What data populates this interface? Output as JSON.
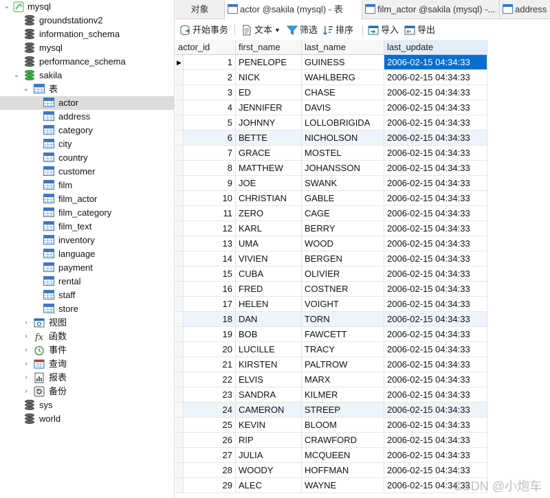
{
  "tree": {
    "connection": "mysql",
    "databases_top": [
      "groundstationv2",
      "information_schema",
      "mysql",
      "performance_schema"
    ],
    "open_db": "sakila",
    "tables_folder": "表",
    "tables": [
      "actor",
      "address",
      "category",
      "city",
      "country",
      "customer",
      "film",
      "film_actor",
      "film_category",
      "film_text",
      "inventory",
      "language",
      "payment",
      "rental",
      "staff",
      "store"
    ],
    "selected_table": "actor",
    "folders": [
      {
        "label": "视图",
        "icon": "view-icon"
      },
      {
        "label": "函数",
        "icon": "function-icon"
      },
      {
        "label": "事件",
        "icon": "event-icon"
      },
      {
        "label": "查询",
        "icon": "query-icon"
      },
      {
        "label": "报表",
        "icon": "report-icon"
      },
      {
        "label": "备份",
        "icon": "backup-icon"
      }
    ],
    "databases_bottom": [
      "sys",
      "world"
    ]
  },
  "tabs": [
    {
      "label": "对象",
      "active": false
    },
    {
      "label": "actor @sakila (mysql) - 表",
      "active": true
    },
    {
      "label": "film_actor @sakila (mysql) -...",
      "active": false
    },
    {
      "label": "address",
      "active": false
    }
  ],
  "toolbar": {
    "begin_transaction": "开始事务",
    "text": "文本",
    "filter": "筛选",
    "sort": "排序",
    "import": "导入",
    "export": "导出"
  },
  "grid": {
    "columns": [
      "actor_id",
      "first_name",
      "last_name",
      "last_update"
    ],
    "rows": [
      [
        "1",
        "PENELOPE",
        "GUINESS",
        "2006-02-15 04:34:33"
      ],
      [
        "2",
        "NICK",
        "WAHLBERG",
        "2006-02-15 04:34:33"
      ],
      [
        "3",
        "ED",
        "CHASE",
        "2006-02-15 04:34:33"
      ],
      [
        "4",
        "JENNIFER",
        "DAVIS",
        "2006-02-15 04:34:33"
      ],
      [
        "5",
        "JOHNNY",
        "LOLLOBRIGIDA",
        "2006-02-15 04:34:33"
      ],
      [
        "6",
        "BETTE",
        "NICHOLSON",
        "2006-02-15 04:34:33"
      ],
      [
        "7",
        "GRACE",
        "MOSTEL",
        "2006-02-15 04:34:33"
      ],
      [
        "8",
        "MATTHEW",
        "JOHANSSON",
        "2006-02-15 04:34:33"
      ],
      [
        "9",
        "JOE",
        "SWANK",
        "2006-02-15 04:34:33"
      ],
      [
        "10",
        "CHRISTIAN",
        "GABLE",
        "2006-02-15 04:34:33"
      ],
      [
        "11",
        "ZERO",
        "CAGE",
        "2006-02-15 04:34:33"
      ],
      [
        "12",
        "KARL",
        "BERRY",
        "2006-02-15 04:34:33"
      ],
      [
        "13",
        "UMA",
        "WOOD",
        "2006-02-15 04:34:33"
      ],
      [
        "14",
        "VIVIEN",
        "BERGEN",
        "2006-02-15 04:34:33"
      ],
      [
        "15",
        "CUBA",
        "OLIVIER",
        "2006-02-15 04:34:33"
      ],
      [
        "16",
        "FRED",
        "COSTNER",
        "2006-02-15 04:34:33"
      ],
      [
        "17",
        "HELEN",
        "VOIGHT",
        "2006-02-15 04:34:33"
      ],
      [
        "18",
        "DAN",
        "TORN",
        "2006-02-15 04:34:33"
      ],
      [
        "19",
        "BOB",
        "FAWCETT",
        "2006-02-15 04:34:33"
      ],
      [
        "20",
        "LUCILLE",
        "TRACY",
        "2006-02-15 04:34:33"
      ],
      [
        "21",
        "KIRSTEN",
        "PALTROW",
        "2006-02-15 04:34:33"
      ],
      [
        "22",
        "ELVIS",
        "MARX",
        "2006-02-15 04:34:33"
      ],
      [
        "23",
        "SANDRA",
        "KILMER",
        "2006-02-15 04:34:33"
      ],
      [
        "24",
        "CAMERON",
        "STREEP",
        "2006-02-15 04:34:33"
      ],
      [
        "25",
        "KEVIN",
        "BLOOM",
        "2006-02-15 04:34:33"
      ],
      [
        "26",
        "RIP",
        "CRAWFORD",
        "2006-02-15 04:34:33"
      ],
      [
        "27",
        "JULIA",
        "MCQUEEN",
        "2006-02-15 04:34:33"
      ],
      [
        "28",
        "WOODY",
        "HOFFMAN",
        "2006-02-15 04:34:33"
      ],
      [
        "29",
        "ALEC",
        "WAYNE",
        "2006-02-15 04:34:33"
      ]
    ],
    "selected_row": 0,
    "selected_col": 3,
    "alt_rows": [
      5,
      17,
      23
    ]
  },
  "watermark": "CSDN @小炮车",
  "colors": {
    "selection": "#0a6ed1",
    "tree_selected": "#dcdcdc",
    "db_open": "#3cb043",
    "table_icon": "#3b78c7"
  }
}
